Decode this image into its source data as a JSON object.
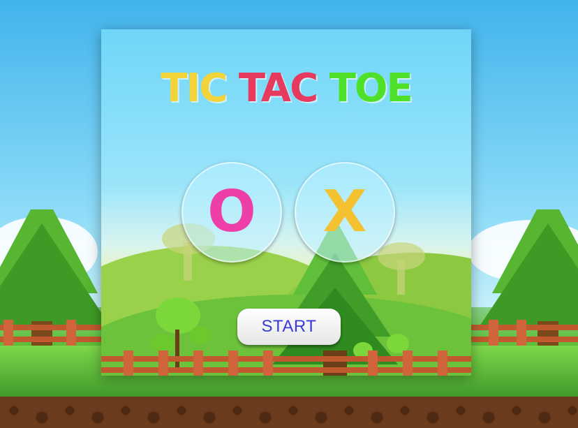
{
  "title": {
    "words": [
      {
        "text": "TIC",
        "color": "#f2d33a"
      },
      {
        "text": "TAC",
        "color": "#e63b5e"
      },
      {
        "text": "TOE",
        "color": "#4fe02a"
      }
    ]
  },
  "choices": {
    "o": {
      "label": "O",
      "color": "#ee3fa8"
    },
    "x": {
      "label": "X",
      "color": "#f4c230"
    }
  },
  "start": {
    "label": "START",
    "color": "#3a3ad8"
  }
}
